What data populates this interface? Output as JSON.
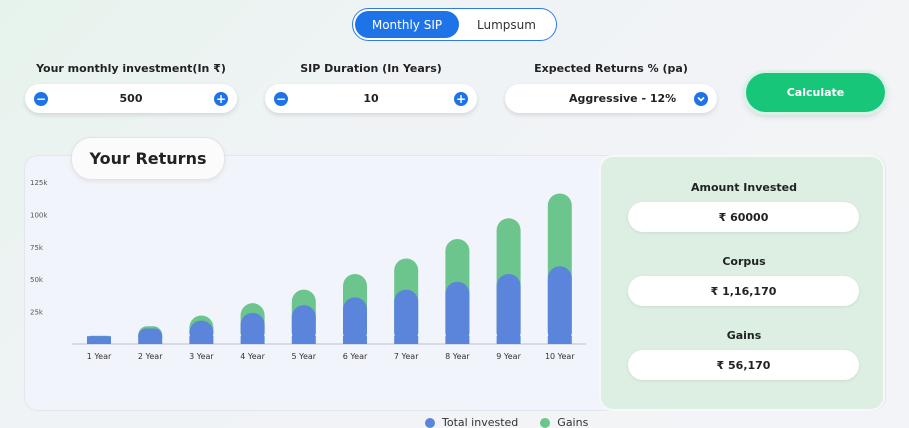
{
  "tabs": [
    {
      "label": "Monthly SIP",
      "active": true
    },
    {
      "label": "Lumpsum",
      "active": false
    }
  ],
  "inputs": {
    "investment": {
      "label": "Your monthly investment(In ₹)",
      "value": "500"
    },
    "duration": {
      "label": "SIP Duration (In Years)",
      "value": "10"
    },
    "returns": {
      "label": "Expected Returns % (pa)",
      "value": "Aggressive - 12%"
    }
  },
  "calculate_label": "Calculate",
  "returns_title": "Your Returns",
  "summary": {
    "invested_label": "Amount Invested",
    "invested_value": "₹ 60000",
    "corpus_label": "Corpus",
    "corpus_value": "₹ 1,16,170",
    "gains_label": "Gains",
    "gains_value": "₹ 56,170"
  },
  "colors": {
    "invested": "#5b85da",
    "gains": "#6cc58d",
    "accent": "#1f73e8",
    "calculate": "#18c67a"
  },
  "chart_data": {
    "type": "bar",
    "stacked": true,
    "categories": [
      "1 Year",
      "2 Year",
      "3 Year",
      "4 Year",
      "5 Year",
      "6 Year",
      "7 Year",
      "8 Year",
      "9 Year",
      "10 Year"
    ],
    "series": [
      {
        "name": "Total invested",
        "values": [
          6000,
          12000,
          18000,
          24000,
          30000,
          36000,
          42000,
          48000,
          54000,
          60000
        ]
      },
      {
        "name": "Gains",
        "values": [
          400,
          1700,
          4000,
          7500,
          12000,
          18000,
          24000,
          33000,
          43000,
          56170
        ]
      }
    ],
    "yticks": [
      "25k",
      "50k",
      "75k",
      "100k",
      "125k"
    ],
    "ylim": [
      0,
      125000
    ],
    "legend_position": "bottom"
  }
}
